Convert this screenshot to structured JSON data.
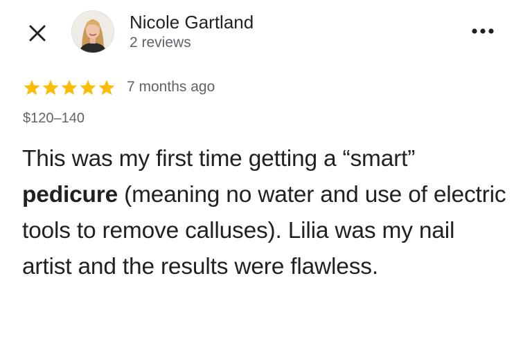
{
  "header": {
    "close_icon": "close-icon",
    "more_icon": "more-horizontal-icon",
    "author": {
      "name": "Nicole Gartland",
      "reviews": "2 reviews",
      "avatar_icon": "avatar-photo"
    }
  },
  "review": {
    "rating": 5,
    "rating_max": 5,
    "star_color": "#fbbc04",
    "time_ago": "7 months ago",
    "price": "$120–140",
    "text_before": "This was my first time getting a “smart” ",
    "text_highlight": "pedicure",
    "text_after": " (meaning no water and use of electric tools to remove calluses). Lilia was my nail artist and the results were flawless."
  }
}
